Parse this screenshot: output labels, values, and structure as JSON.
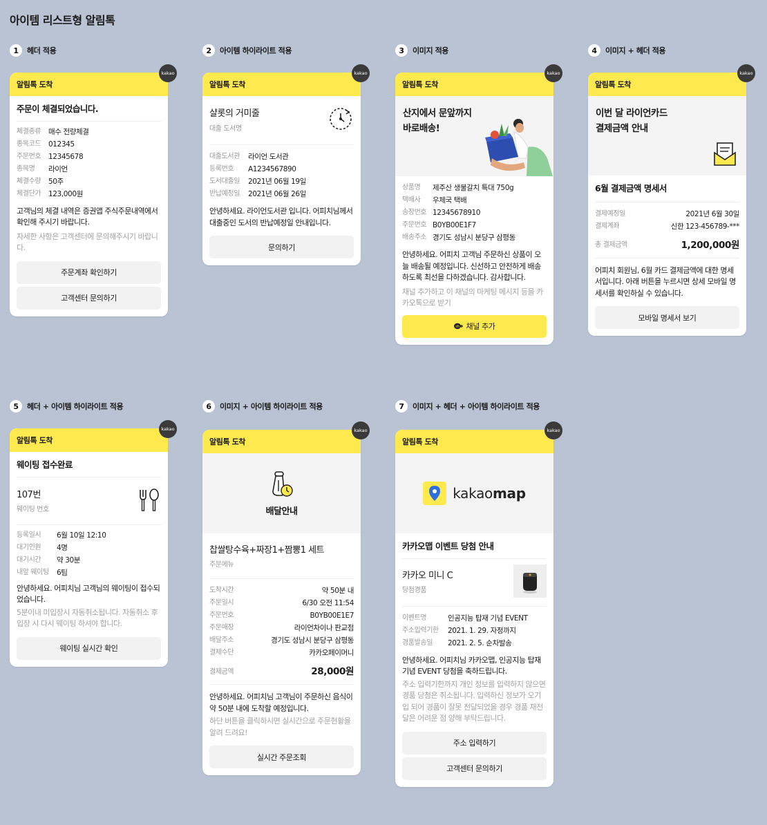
{
  "page_title": "아이템 리스트형 알림톡",
  "header_label": "알림톡 도착",
  "kakao_badge": "kakao",
  "sections": [
    {
      "num": "1",
      "label": "헤더 적용"
    },
    {
      "num": "2",
      "label": "아이템 하이라이트 적용"
    },
    {
      "num": "3",
      "label": "이미지 적용"
    },
    {
      "num": "4",
      "label": "이미지 + 헤더 적용"
    },
    {
      "num": "5",
      "label": "헤더 + 아이템 하이라이트 적용"
    },
    {
      "num": "6",
      "label": "이미지 + 아이템 하이라이트 적용"
    },
    {
      "num": "7",
      "label": "이미지 + 헤더 + 아이템 하이라이트 적용"
    }
  ],
  "card1": {
    "title": "주문이 체결되었습니다.",
    "items": [
      {
        "k": "체결종류",
        "v": "매수 전량체결"
      },
      {
        "k": "종목코드",
        "v": "012345"
      },
      {
        "k": "주문번호",
        "v": "12345678"
      },
      {
        "k": "종목명",
        "v": "라이언"
      },
      {
        "k": "체결수량",
        "v": "50주"
      },
      {
        "k": "체결단가",
        "v": "123,000원"
      }
    ],
    "message": "고객님의 체결 내역은 증권앱 주식주문내역에서 확인해 주시기 바랍니다.",
    "sub": "자세한 사항은 고객센터에 문의해주시기 바랍니다.",
    "buttons": [
      "주문계좌 확인하기",
      "고객센터 문의하기"
    ]
  },
  "card2": {
    "highlight_title": "샬롯의 거미줄",
    "highlight_sub": "대출 도서명",
    "items": [
      {
        "k": "대출도서관",
        "v": "라이언 도서관"
      },
      {
        "k": "등록번호",
        "v": "A1234567890"
      },
      {
        "k": "도서대출일",
        "v": "2021년 06월 19일"
      },
      {
        "k": "반납예정일",
        "v": "2021년 06월 26일"
      }
    ],
    "message": "안녕하세요. 라이언도서관 입니다. 어피치님께서 대출중인 도서의 반납예정일 안내입니다.",
    "buttons": [
      "문의하기"
    ]
  },
  "card3": {
    "image_title_1": "산지에서 문앞까지",
    "image_title_2": "바로배송!",
    "items": [
      {
        "k": "상품명",
        "v": "제주산 생물갈치 특대 750g"
      },
      {
        "k": "택배사",
        "v": "우체국 택배"
      },
      {
        "k": "송장번호",
        "v": "12345678910"
      },
      {
        "k": "주문번호",
        "v": "B0YB00E1F7"
      },
      {
        "k": "배송주소",
        "v": "경기도 성남시 분당구 삼평동"
      }
    ],
    "message": "안녕하세요. 어피치 고객님 주문하신 상품이 오늘 배송될 예정입니다. 신선하고 안전하게 배송하도록 최선을 다하겠습니다. 감사합니다.",
    "sub": "채널 추가하고 이 채널의 마케팅 메시지 등을 카카오톡으로 받기",
    "button": "채널 추가",
    "button_icon": "plus"
  },
  "card4": {
    "image_title_1": "이번 달 라이언카드",
    "image_title_2": "결제금액 안내",
    "title": "6월 결제금액 명세서",
    "items": [
      {
        "k": "결제예정일",
        "v": "2021년 6월 30일"
      },
      {
        "k": "결제계좌",
        "v": "신한 123-456789-***"
      }
    ],
    "total_label": "총 결제금액",
    "total_value": "1,200,000원",
    "message": "어피치 회원님, 6월 카드 결제금액에 대한 명세서입니다. 아래 버튼을 누르시면 상세 모바일 명세서를 확인하실 수 있습니다.",
    "buttons": [
      "모바일 명세서 보기"
    ]
  },
  "card5": {
    "title": "웨이팅 접수완료",
    "highlight_title": "107번",
    "highlight_sub": "웨이팅 번호",
    "items": [
      {
        "k": "등록일시",
        "v": "6월 10일 12:10"
      },
      {
        "k": "대기인원",
        "v": "4명"
      },
      {
        "k": "대기시간",
        "v": "약 30분"
      },
      {
        "k": "내앞 웨이팅",
        "v": "6팀"
      }
    ],
    "message": "안녕하세요. 어피치님 고객님의 웨이팅이 접수되었습니다.",
    "sub": "5분이내 미입장시 자동취소됩니다. 자동취소 후 입장 시 다시 웨이팅 하셔야 합니다.",
    "buttons": [
      "웨이팅 실시간 확인"
    ]
  },
  "card6": {
    "image_caption": "배달안내",
    "highlight_title": "찹쌀탕수육+짜장1+짬뽕1 세트",
    "highlight_sub": "주문메뉴",
    "items": [
      {
        "k": "도착시간",
        "v": "약 50분 내"
      },
      {
        "k": "주문일시",
        "v": "6/30 오전 11:54"
      },
      {
        "k": "주문번호",
        "v": "B0YB00E1E7"
      },
      {
        "k": "주문매장",
        "v": "라이언차이나 판교점"
      },
      {
        "k": "배달주소",
        "v": "경기도 성남시 분당구 삼평동"
      },
      {
        "k": "결제수단",
        "v": "카카오페이머니"
      }
    ],
    "total_label": "결제금액",
    "total_value": "28,000원",
    "message": "안녕하세요. 어피치님 고객님이 주문하신 음식이 약 50분 내에 도착할 예정입니다.",
    "sub": "하단 버튼을 클릭하시면 실시간으로 주문현황을 알려 드려요!",
    "buttons": [
      "실시간 주문조회"
    ]
  },
  "card7": {
    "logo_text_1": "kakao",
    "logo_text_2": "map",
    "title": "카카오맵 이벤트 당첨 안내",
    "highlight_title": "카카오 미니 C",
    "highlight_sub": "당첨경품",
    "items": [
      {
        "k": "이벤트명",
        "v": "인공지능 탑재 기념 EVENT"
      },
      {
        "k": "주소입력기한",
        "v": "2021. 1. 29. 자정까지"
      },
      {
        "k": "경품발송일",
        "v": "2021. 2. 5. 순차발송"
      }
    ],
    "message": "안녕하세요. 어피치님 카카오맵, 인공지능 탑재 기념 EVENT 당첨을 축하드립니다.",
    "sub": "주소 입력기한까지 개인 정보를 입력하지 않으면 경품 당첨은 취소됩니다. 입력하신 정보가 오기입 되어 경품이 잘못 전달되었을 경우 경품 재전달은 어려운 점 양해 부탁드립니다.",
    "buttons": [
      "주소 입력하기",
      "고객센터 문의하기"
    ]
  }
}
